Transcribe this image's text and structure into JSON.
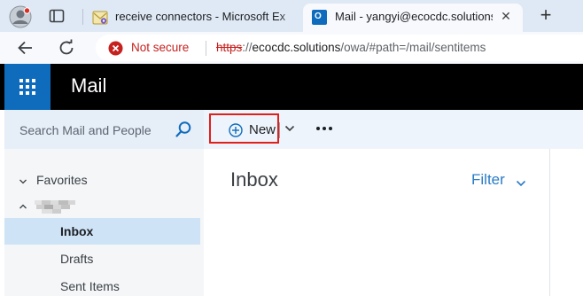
{
  "browser": {
    "tabs": [
      {
        "title": "receive connectors - Microsoft Ex",
        "icon": "exchange-admin-favicon"
      },
      {
        "title": "Mail - yangyi@ecocdc.solutions",
        "icon": "outlook-favicon",
        "active": true
      }
    ],
    "outlook_favicon_letter": "O",
    "new_tab_glyph": "+",
    "close_glyph": "✕",
    "security_label": "Not secure",
    "url": {
      "scheme": "https",
      "rest": "://",
      "host": "ecocdc.solutions",
      "path": "/owa/#path=/mail/sentitems"
    }
  },
  "app": {
    "title": "Mail",
    "brand_color": "#0f6cbd"
  },
  "search": {
    "placeholder": "Search Mail and People"
  },
  "commands": {
    "new_label": "New"
  },
  "folders": {
    "favorites_label": "Favorites",
    "items": [
      {
        "label": "Inbox",
        "selected": true
      },
      {
        "label": "Drafts",
        "selected": false
      },
      {
        "label": "Sent Items",
        "selected": false
      }
    ]
  },
  "list": {
    "title": "Inbox",
    "filter_label": "Filter"
  }
}
